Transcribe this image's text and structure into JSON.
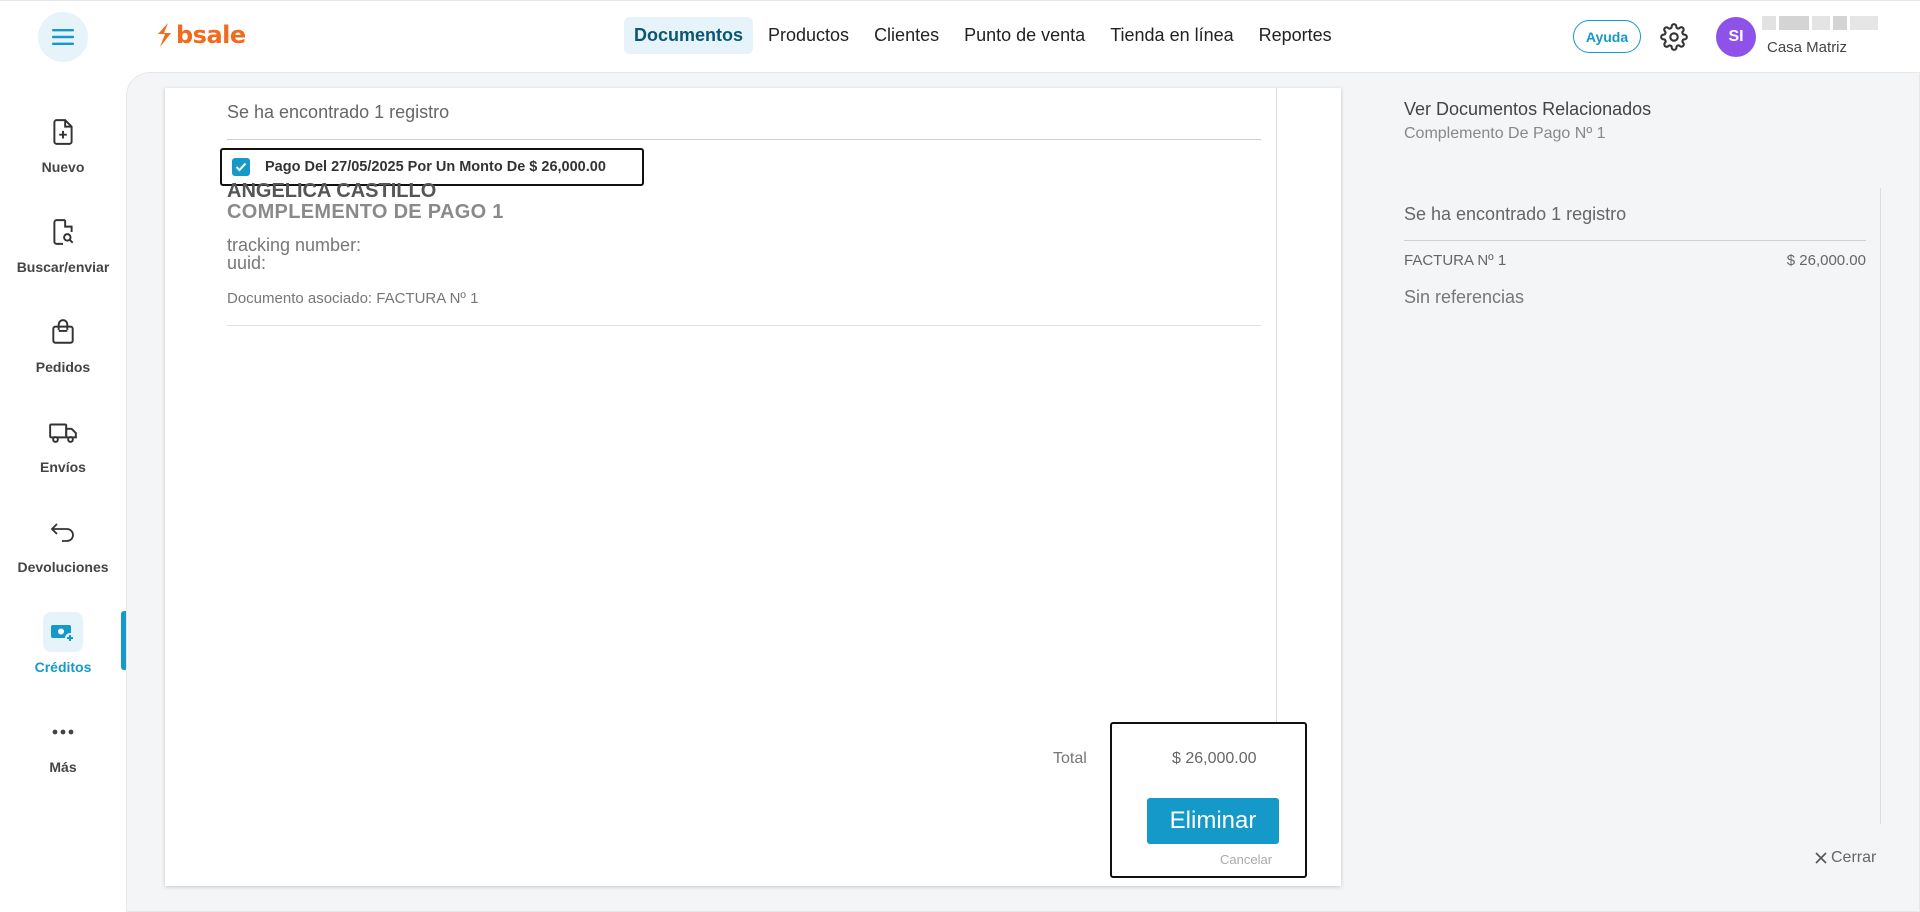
{
  "header": {
    "brand": "bsale",
    "nav": [
      "Documentos",
      "Productos",
      "Clientes",
      "Punto de venta",
      "Tienda en línea",
      "Reportes"
    ],
    "help_label": "Ayuda",
    "avatar_initials": "SI",
    "branch": "Casa Matriz"
  },
  "sidebar": {
    "items": [
      {
        "label": "Nuevo",
        "icon": "file-plus-icon"
      },
      {
        "label": "Buscar/enviar",
        "icon": "file-search-icon"
      },
      {
        "label": "Pedidos",
        "icon": "shopping-bag-icon"
      },
      {
        "label": "Envíos",
        "icon": "truck-icon"
      },
      {
        "label": "Devoluciones",
        "icon": "return-arrow-icon"
      },
      {
        "label": "Créditos",
        "icon": "money-add-icon"
      },
      {
        "label": "Más",
        "icon": "more-dots-icon"
      }
    ],
    "active": "Créditos"
  },
  "document": {
    "records_found": "Se ha encontrado 1 registro",
    "payment_label": "Pago Del 27/05/2025 Por Un Monto De $ 26,000.00",
    "payment_checked": true,
    "client_name": "ANGELICA CASTILLO",
    "doc_title": "COMPLEMENTO DE PAGO 1",
    "tracking_label": "tracking number:",
    "uuid_label": "uuid:",
    "associated": "Documento asociado: FACTURA Nº 1",
    "total_label": "Total",
    "total_value": "$ 26,000.00",
    "delete_label": "Eliminar",
    "cancel_label": "Cancelar"
  },
  "related": {
    "title": "Ver Documentos Relacionados",
    "subtitle": "Complemento De Pago Nº 1",
    "records_found": "Se ha encontrado 1 registro",
    "reference_doc": "FACTURA Nº 1",
    "reference_amount": "$ 26,000.00",
    "no_refs": "Sin referencias",
    "close_label": "Cerrar"
  },
  "colors": {
    "accent": "#1599c8",
    "brand": "#f26b1d",
    "avatar": "#8e52e8",
    "nav_active_bg": "#e6f3f9"
  }
}
